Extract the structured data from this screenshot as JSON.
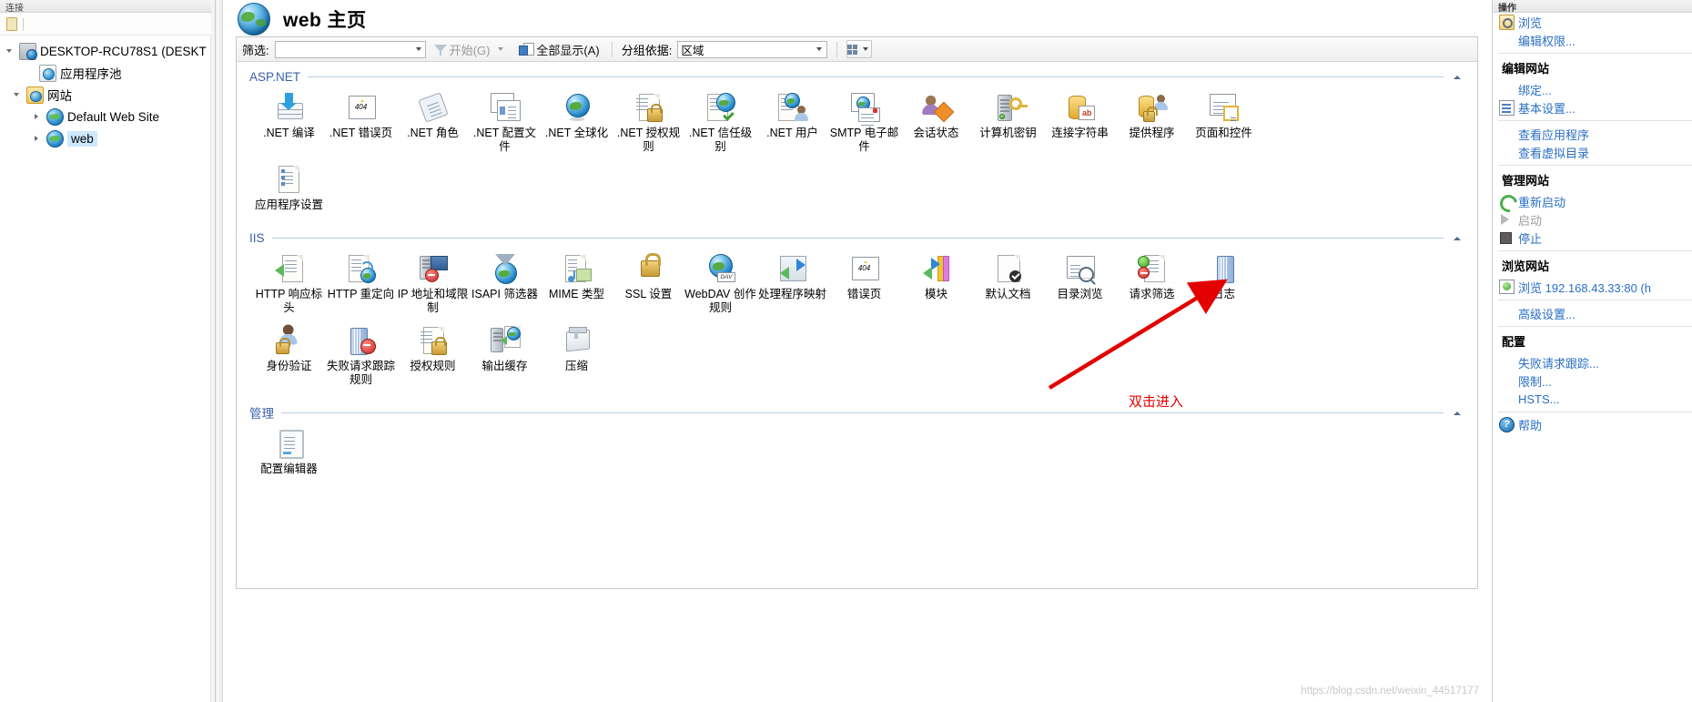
{
  "window": {
    "tree_panel_header": "连接",
    "actions_panel_header": "操作"
  },
  "tree": {
    "nodes": [
      {
        "label": "DESKTOP-RCU78S1 (DESKT",
        "icon": "server-icon",
        "expanded": true,
        "depth": 0
      },
      {
        "label": "应用程序池",
        "icon": "app-pool-icon",
        "expanded": null,
        "depth": 1
      },
      {
        "label": "网站",
        "icon": "sites-folder-icon",
        "expanded": true,
        "depth": 1
      },
      {
        "label": "Default Web Site",
        "icon": "website-globe-icon",
        "expanded": false,
        "depth": 2
      },
      {
        "label": "web",
        "icon": "website-globe-icon",
        "expanded": false,
        "depth": 2,
        "selected": true
      }
    ]
  },
  "page": {
    "title": "web 主页",
    "icon": "globe-icon"
  },
  "toolbar": {
    "filter_label": "筛选:",
    "filter_value": "",
    "filter_placeholder": "",
    "start_label": "开始(G)",
    "show_all_label": "全部显示(A)",
    "group_by_label": "分组依据:",
    "group_by_value": "区域",
    "view_label": ""
  },
  "sections": [
    {
      "id": "aspnet",
      "title": "ASP.NET",
      "collapse_icon": "chevron-up-icon",
      "items": [
        {
          "label": ".NET 编译",
          "icon": "net-compilation-icon"
        },
        {
          "label": ".NET 错误页",
          "icon": "net-error-pages-icon"
        },
        {
          "label": ".NET 角色",
          "icon": "net-roles-icon"
        },
        {
          "label": ".NET 配置文件",
          "icon": "net-profile-icon"
        },
        {
          "label": ".NET 全球化",
          "icon": "net-globalization-icon"
        },
        {
          "label": ".NET 授权规则",
          "icon": "net-authorization-rules-icon"
        },
        {
          "label": ".NET 信任级别",
          "icon": "net-trust-levels-icon"
        },
        {
          "label": ".NET 用户",
          "icon": "net-users-icon"
        },
        {
          "label": "SMTP 电子邮件",
          "icon": "smtp-email-icon"
        },
        {
          "label": "会话状态",
          "icon": "session-state-icon"
        },
        {
          "label": "计算机密钥",
          "icon": "machine-key-icon"
        },
        {
          "label": "连接字符串",
          "icon": "connection-strings-icon"
        },
        {
          "label": "提供程序",
          "icon": "providers-icon"
        },
        {
          "label": "页面和控件",
          "icon": "pages-and-controls-icon"
        },
        {
          "label": "应用程序设置",
          "icon": "application-settings-icon"
        }
      ]
    },
    {
      "id": "iis",
      "title": "IIS",
      "collapse_icon": "chevron-up-icon",
      "items": [
        {
          "label": "HTTP 响应标头",
          "icon": "http-response-headers-icon"
        },
        {
          "label": "HTTP 重定向",
          "icon": "http-redirect-icon"
        },
        {
          "label": "IP 地址和域限制",
          "icon": "ip-address-domain-restrictions-icon"
        },
        {
          "label": "ISAPI 筛选器",
          "icon": "isapi-filters-icon"
        },
        {
          "label": "MIME 类型",
          "icon": "mime-types-icon"
        },
        {
          "label": "SSL 设置",
          "icon": "ssl-settings-icon"
        },
        {
          "label": "WebDAV 创作规则",
          "icon": "webdav-authoring-rules-icon"
        },
        {
          "label": "处理程序映射",
          "icon": "handler-mappings-icon"
        },
        {
          "label": "错误页",
          "icon": "error-pages-icon"
        },
        {
          "label": "模块",
          "icon": "modules-icon"
        },
        {
          "label": "默认文档",
          "icon": "default-document-icon"
        },
        {
          "label": "目录浏览",
          "icon": "directory-browsing-icon"
        },
        {
          "label": "请求筛选",
          "icon": "request-filtering-icon"
        },
        {
          "label": "日志",
          "icon": "logging-icon"
        },
        {
          "label": "身份验证",
          "icon": "authentication-icon"
        },
        {
          "label": "失败请求跟踪规则",
          "icon": "failed-request-tracing-rules-icon"
        },
        {
          "label": "授权规则",
          "icon": "authorization-rules-icon"
        },
        {
          "label": "输出缓存",
          "icon": "output-caching-icon"
        },
        {
          "label": "压缩",
          "icon": "compression-icon"
        }
      ]
    },
    {
      "id": "management",
      "title": "管理",
      "collapse_icon": "chevron-up-icon",
      "items": [
        {
          "label": "配置编辑器",
          "icon": "configuration-editor-icon"
        }
      ]
    }
  ],
  "actions": {
    "groups": [
      {
        "title": null,
        "items": [
          {
            "label": "浏览",
            "icon": "browse-folder-icon",
            "disabled": false
          },
          {
            "label": "编辑权限...",
            "icon": null,
            "disabled": false
          }
        ]
      },
      {
        "title": "编辑网站",
        "items": [
          {
            "label": "绑定...",
            "icon": null,
            "disabled": false
          },
          {
            "label": "基本设置...",
            "icon": "basic-settings-icon",
            "disabled": false
          }
        ]
      },
      {
        "title": null,
        "items": [
          {
            "label": "查看应用程序",
            "icon": null,
            "disabled": false
          },
          {
            "label": "查看虚拟目录",
            "icon": null,
            "disabled": false
          }
        ]
      },
      {
        "title": "管理网站",
        "items": [
          {
            "label": "重新启动",
            "icon": "restart-icon",
            "disabled": false
          },
          {
            "label": "启动",
            "icon": "play-icon",
            "disabled": true
          },
          {
            "label": "停止",
            "icon": "stop-icon",
            "disabled": false
          }
        ]
      },
      {
        "title": "浏览网站",
        "items": [
          {
            "label": "浏览 192.168.43.33:80 (h",
            "icon": "browse-site-icon",
            "disabled": false
          },
          {
            "label": "高级设置...",
            "icon": null,
            "disabled": false
          }
        ]
      },
      {
        "title": "配置",
        "items": [
          {
            "label": "失败请求跟踪...",
            "icon": null,
            "disabled": false
          },
          {
            "label": "限制...",
            "icon": null,
            "disabled": false
          },
          {
            "label": "HSTS...",
            "icon": null,
            "disabled": false
          }
        ]
      },
      {
        "title": null,
        "items": [
          {
            "label": "帮助",
            "icon": "help-icon",
            "disabled": false
          }
        ]
      }
    ]
  },
  "annotation": {
    "text": "双击进入",
    "color": "#e30000"
  },
  "watermark": "https://blog.csdn.net/weixin_44517177"
}
